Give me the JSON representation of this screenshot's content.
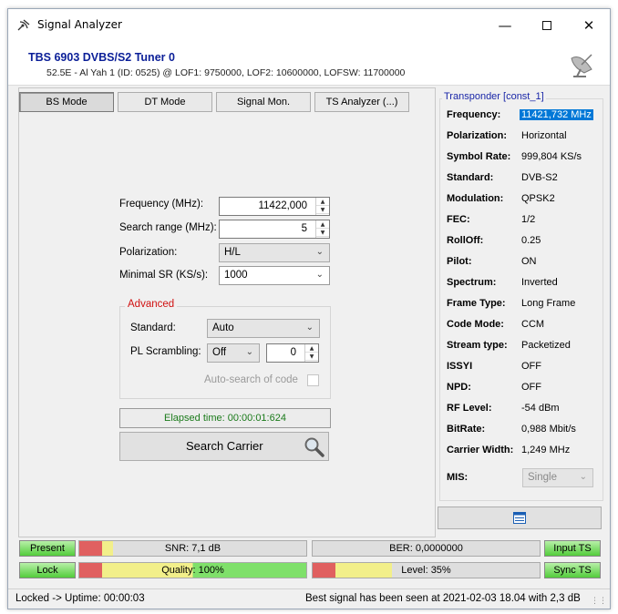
{
  "window": {
    "title": "Signal Analyzer",
    "minimize_icon": "minimize-icon",
    "maximize_icon": "maximize-icon",
    "close_icon": "close-icon"
  },
  "header": {
    "device": "TBS 6903 DVBS/S2 Tuner 0",
    "info": "52.5E - Al Yah 1 (ID: 0525) @ LOF1: 9750000, LOF2: 10600000, LOFSW: 11700000",
    "logo_icon": "satellite-dish-icon"
  },
  "tabs": [
    {
      "label": "BS Mode"
    },
    {
      "label": "DT Mode"
    },
    {
      "label": "Signal Mon."
    },
    {
      "label": "TS Analyzer (...)"
    }
  ],
  "form": {
    "frequency": {
      "label": "Frequency (MHz):",
      "value": "11422,000"
    },
    "search_range": {
      "label": "Search range (MHz):",
      "value": "5"
    },
    "polarization": {
      "label": "Polarization:",
      "value": "H/L"
    },
    "min_sr": {
      "label": "Minimal SR (KS/s):",
      "value": "1000"
    }
  },
  "advanced": {
    "title": "Advanced",
    "standard": {
      "label": "Standard:",
      "value": "Auto"
    },
    "pl_scrambling": {
      "label": "PL Scrambling:",
      "value": "Off",
      "number": "0"
    },
    "auto_search": {
      "label": "Auto-search of code"
    }
  },
  "elapsed": "Elapsed time: 00:00:01:624",
  "search_button": {
    "label": "Search Carrier",
    "icon": "magnifier-icon"
  },
  "transponder": {
    "title": "Transponder [const_1]",
    "rows": [
      {
        "key": "Frequency:",
        "value": "11421,732 MHz"
      },
      {
        "key": "Polarization:",
        "value": "Horizontal"
      },
      {
        "key": "Symbol Rate:",
        "value": "999,804 KS/s"
      },
      {
        "key": "Standard:",
        "value": "DVB-S2"
      },
      {
        "key": "Modulation:",
        "value": "QPSK2"
      },
      {
        "key": "FEC:",
        "value": "1/2"
      },
      {
        "key": "RollOff:",
        "value": "0.25"
      },
      {
        "key": "Pilot:",
        "value": "ON"
      },
      {
        "key": "Spectrum:",
        "value": "Inverted"
      },
      {
        "key": "Frame Type:",
        "value": "Long Frame"
      },
      {
        "key": "Code Mode:",
        "value": "CCM"
      },
      {
        "key": "Stream type:",
        "value": "Packetized"
      },
      {
        "key": "ISSYI",
        "value": "OFF"
      },
      {
        "key": "NPD:",
        "value": "OFF"
      },
      {
        "key": "RF Level:",
        "value": "-54 dBm"
      },
      {
        "key": "BitRate:",
        "value": "0,988 Mbit/s"
      },
      {
        "key": "Carrier Width:",
        "value": "1,249 MHz"
      }
    ],
    "mis": {
      "key": "MIS:",
      "value": "Single"
    },
    "bottom_button_icon": "list-icon"
  },
  "indicators": {
    "present": "Present",
    "lock": "Lock",
    "input_ts": "Input TS",
    "sync_ts": "Sync TS",
    "snr": {
      "label": "SNR: 7,1 dB",
      "fraction": 0.15
    },
    "ber": {
      "label": "BER: 0,0000000",
      "fraction": 0
    },
    "quality": {
      "label": "Quality: 100%",
      "fraction": 1.0
    },
    "level": {
      "label": "Level: 35%",
      "fraction": 0.35
    }
  },
  "colors": {
    "led_green": "#52cc3b",
    "bar_red": "#e06060",
    "bar_yellow": "#f2ef8a",
    "bar_green": "#7fe06a",
    "title_blue": "#0b1f98",
    "advanced_red": "#d01010",
    "selection": "#0078d7"
  },
  "status": {
    "left": "Locked -> Uptime: 00:00:03",
    "right": "Best signal has been seen at 2021-02-03 18.04 with 2,3 dB"
  }
}
